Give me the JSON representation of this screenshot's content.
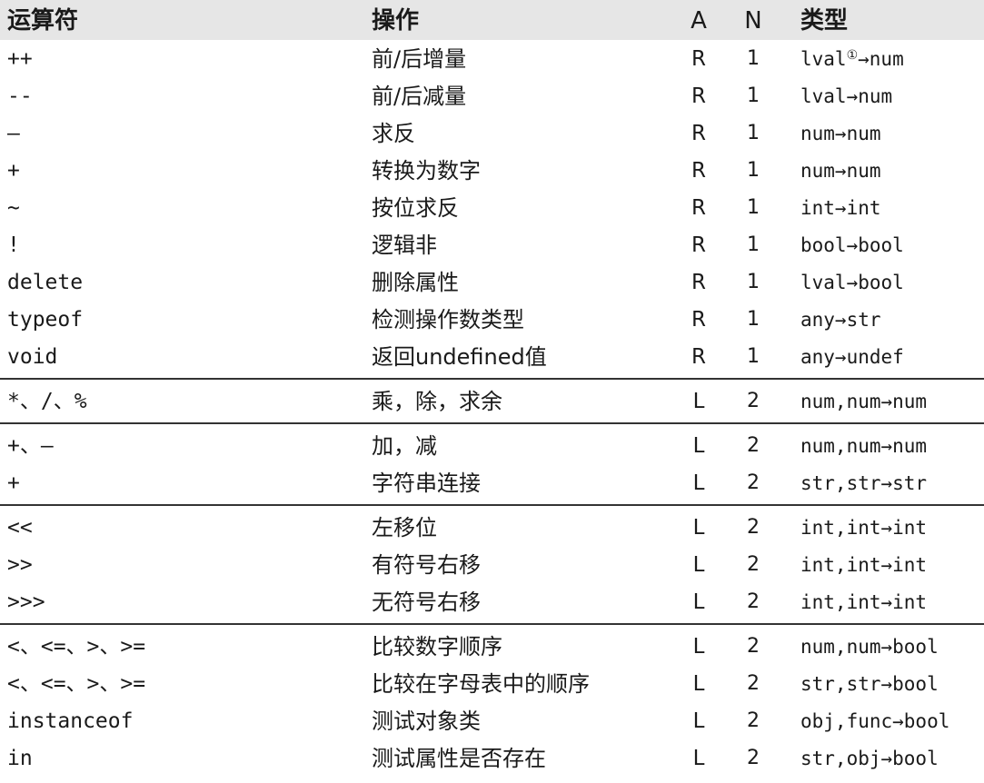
{
  "header": {
    "operator": "运算符",
    "operation": "操作",
    "a": "A",
    "n": "N",
    "type": "类型"
  },
  "groups": [
    {
      "rows": [
        {
          "op": "++",
          "desc": "前/后增量",
          "a": "R",
          "n": "1",
          "type": "lval",
          "sup": "①",
          "type2": "→num"
        },
        {
          "op": "--",
          "desc": "前/后减量",
          "a": "R",
          "n": "1",
          "type": "lval→num"
        },
        {
          "op": "—",
          "desc": "求反",
          "a": "R",
          "n": "1",
          "type": "num→num"
        },
        {
          "op": "+",
          "desc": "转换为数字",
          "a": "R",
          "n": "1",
          "type": "num→num"
        },
        {
          "op": "~",
          "desc": "按位求反",
          "a": "R",
          "n": "1",
          "type": "int→int"
        },
        {
          "op": "!",
          "desc": "逻辑非",
          "a": "R",
          "n": "1",
          "type": "bool→bool"
        },
        {
          "op": "delete",
          "desc": "删除属性",
          "a": "R",
          "n": "1",
          "type": "lval→bool"
        },
        {
          "op": "typeof",
          "desc": "检测操作数类型",
          "a": "R",
          "n": "1",
          "type": "any→str"
        },
        {
          "op": "void",
          "desc": "返回undefined值",
          "a": "R",
          "n": "1",
          "type": "any→undef"
        }
      ]
    },
    {
      "rows": [
        {
          "op": "*、/、%",
          "desc": "乘，除，求余",
          "a": "L",
          "n": "2",
          "type": "num,num→num"
        }
      ]
    },
    {
      "rows": [
        {
          "op": "+、—",
          "desc": "加，减",
          "a": "L",
          "n": "2",
          "type": "num,num→num"
        },
        {
          "op": "+",
          "desc": "字符串连接",
          "a": "L",
          "n": "2",
          "type": "str,str→str"
        }
      ]
    },
    {
      "rows": [
        {
          "op": "<<",
          "desc": "左移位",
          "a": "L",
          "n": "2",
          "type": "int,int→int"
        },
        {
          "op": ">>",
          "desc": "有符号右移",
          "a": "L",
          "n": "2",
          "type": "int,int→int"
        },
        {
          "op": ">>>",
          "desc": "无符号右移",
          "a": "L",
          "n": "2",
          "type": "int,int→int"
        }
      ]
    },
    {
      "rows": [
        {
          "op": "<、<=、>、>=",
          "desc": "比较数字顺序",
          "a": "L",
          "n": "2",
          "type": "num,num→bool"
        },
        {
          "op": "<、<=、>、>=",
          "desc": "比较在字母表中的顺序",
          "a": "L",
          "n": "2",
          "type": "str,str→bool"
        },
        {
          "op": "instanceof",
          "desc": "测试对象类",
          "a": "L",
          "n": "2",
          "type": "obj,func→bool"
        },
        {
          "op": "in",
          "desc": "测试属性是否存在",
          "a": "L",
          "n": "2",
          "type": "str,obj→bool"
        }
      ]
    }
  ]
}
